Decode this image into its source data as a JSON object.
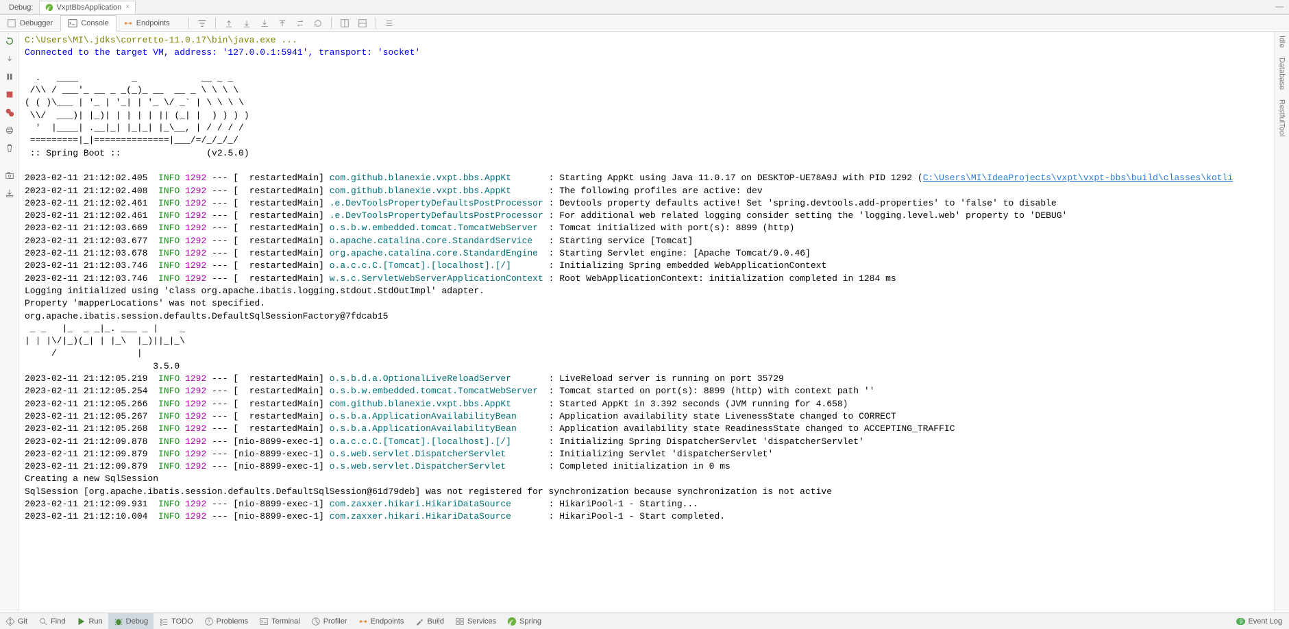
{
  "tabs": {
    "debug_label": "Debug:",
    "app_label": "VxptBbsApplication",
    "close_x": "×"
  },
  "inner_tabs": {
    "debugger": "Debugger",
    "console": "Console",
    "endpoints": "Endpoints"
  },
  "right_sidebar": {
    "idle": "Idle",
    "database": "Database",
    "restful": "RestfulTool"
  },
  "status": {
    "git": "Git",
    "find": "Find",
    "run": "Run",
    "debug": "Debug",
    "todo": "TODO",
    "problems": "Problems",
    "terminal": "Terminal",
    "profiler": "Profiler",
    "endpoints": "Endpoints",
    "build": "Build",
    "services": "Services",
    "spring": "Spring",
    "event_log": "Event Log",
    "badge_count": "9"
  },
  "console": {
    "java_path": "C:\\Users\\MI\\.jdks\\corretto-11.0.17\\bin\\java.exe ...",
    "connected": "Connected to the target VM, address: '127.0.0.1:5941', transport: 'socket'",
    "banner": "  .   ____          _            __ _ _\n /\\\\ / ___'_ __ _ _(_)_ __  __ _ \\ \\ \\ \\\n( ( )\\___ | '_ | '_| | '_ \\/ _` | \\ \\ \\ \\\n \\\\/  ___)| |_)| | | | | || (_| |  ) ) ) )\n  '  |____| .__|_| |_|_| |_\\__, | / / / /\n =========|_|==============|___/=/_/_/_/\n :: Spring Boot ::                (v2.5.0)\n",
    "lines": [
      {
        "ts": "2023-02-11 21:12:02.405",
        "level": "INFO",
        "pid": "1292",
        "thread": "[  restartedMain]",
        "logger": "com.github.blanexie.vxpt.bbs.AppKt",
        "msg": ": Starting AppKt using Java 11.0.17 on DESKTOP-UE78A9J with PID 1292 (",
        "link": "C:\\Users\\MI\\IdeaProjects\\vxpt\\vxpt-bbs\\build\\classes\\kotli"
      },
      {
        "ts": "2023-02-11 21:12:02.408",
        "level": "INFO",
        "pid": "1292",
        "thread": "[  restartedMain]",
        "logger": "com.github.blanexie.vxpt.bbs.AppKt",
        "msg": ": The following profiles are active: dev"
      },
      {
        "ts": "2023-02-11 21:12:02.461",
        "level": "INFO",
        "pid": "1292",
        "thread": "[  restartedMain]",
        "logger": ".e.DevToolsPropertyDefaultsPostProcessor",
        "msg": ": Devtools property defaults active! Set 'spring.devtools.add-properties' to 'false' to disable"
      },
      {
        "ts": "2023-02-11 21:12:02.461",
        "level": "INFO",
        "pid": "1292",
        "thread": "[  restartedMain]",
        "logger": ".e.DevToolsPropertyDefaultsPostProcessor",
        "msg": ": For additional web related logging consider setting the 'logging.level.web' property to 'DEBUG'"
      },
      {
        "ts": "2023-02-11 21:12:03.669",
        "level": "INFO",
        "pid": "1292",
        "thread": "[  restartedMain]",
        "logger": "o.s.b.w.embedded.tomcat.TomcatWebServer",
        "msg": ": Tomcat initialized with port(s): 8899 (http)"
      },
      {
        "ts": "2023-02-11 21:12:03.677",
        "level": "INFO",
        "pid": "1292",
        "thread": "[  restartedMain]",
        "logger": "o.apache.catalina.core.StandardService",
        "msg": ": Starting service [Tomcat]"
      },
      {
        "ts": "2023-02-11 21:12:03.678",
        "level": "INFO",
        "pid": "1292",
        "thread": "[  restartedMain]",
        "logger": "org.apache.catalina.core.StandardEngine",
        "msg": ": Starting Servlet engine: [Apache Tomcat/9.0.46]"
      },
      {
        "ts": "2023-02-11 21:12:03.746",
        "level": "INFO",
        "pid": "1292",
        "thread": "[  restartedMain]",
        "logger": "o.a.c.c.C.[Tomcat].[localhost].[/]",
        "msg": ": Initializing Spring embedded WebApplicationContext"
      },
      {
        "ts": "2023-02-11 21:12:03.746",
        "level": "INFO",
        "pid": "1292",
        "thread": "[  restartedMain]",
        "logger": "w.s.c.ServletWebServerApplicationContext",
        "msg": ": Root WebApplicationContext: initialization completed in 1284 ms"
      }
    ],
    "plain_block": "Logging initialized using 'class org.apache.ibatis.logging.stdout.StdOutImpl' adapter.\nProperty 'mapperLocations' was not specified.\norg.apache.ibatis.session.defaults.DefaultSqlSessionFactory@7fdcab15\n _ _   |_  _ _|_. ___ _ |    _ \n| | |\\/|_)(_| | |_\\  |_)||_|_\\ \n     /               |         \n                        3.5.0 ",
    "lines2": [
      {
        "ts": "2023-02-11 21:12:05.219",
        "level": "INFO",
        "pid": "1292",
        "thread": "[  restartedMain]",
        "logger": "o.s.b.d.a.OptionalLiveReloadServer",
        "msg": ": LiveReload server is running on port 35729"
      },
      {
        "ts": "2023-02-11 21:12:05.254",
        "level": "INFO",
        "pid": "1292",
        "thread": "[  restartedMain]",
        "logger": "o.s.b.w.embedded.tomcat.TomcatWebServer",
        "msg": ": Tomcat started on port(s): 8899 (http) with context path ''"
      },
      {
        "ts": "2023-02-11 21:12:05.266",
        "level": "INFO",
        "pid": "1292",
        "thread": "[  restartedMain]",
        "logger": "com.github.blanexie.vxpt.bbs.AppKt",
        "msg": ": Started AppKt in 3.392 seconds (JVM running for 4.658)"
      },
      {
        "ts": "2023-02-11 21:12:05.267",
        "level": "INFO",
        "pid": "1292",
        "thread": "[  restartedMain]",
        "logger": "o.s.b.a.ApplicationAvailabilityBean",
        "msg": ": Application availability state LivenessState changed to CORRECT"
      },
      {
        "ts": "2023-02-11 21:12:05.268",
        "level": "INFO",
        "pid": "1292",
        "thread": "[  restartedMain]",
        "logger": "o.s.b.a.ApplicationAvailabilityBean",
        "msg": ": Application availability state ReadinessState changed to ACCEPTING_TRAFFIC"
      },
      {
        "ts": "2023-02-11 21:12:09.878",
        "level": "INFO",
        "pid": "1292",
        "thread": "[nio-8899-exec-1]",
        "logger": "o.a.c.c.C.[Tomcat].[localhost].[/]",
        "msg": ": Initializing Spring DispatcherServlet 'dispatcherServlet'"
      },
      {
        "ts": "2023-02-11 21:12:09.879",
        "level": "INFO",
        "pid": "1292",
        "thread": "[nio-8899-exec-1]",
        "logger": "o.s.web.servlet.DispatcherServlet",
        "msg": ": Initializing Servlet 'dispatcherServlet'"
      },
      {
        "ts": "2023-02-11 21:12:09.879",
        "level": "INFO",
        "pid": "1292",
        "thread": "[nio-8899-exec-1]",
        "logger": "o.s.web.servlet.DispatcherServlet",
        "msg": ": Completed initialization in 0 ms"
      }
    ],
    "plain_block2": "Creating a new SqlSession\nSqlSession [org.apache.ibatis.session.defaults.DefaultSqlSession@61d79deb] was not registered for synchronization because synchronization is not active",
    "lines3": [
      {
        "ts": "2023-02-11 21:12:09.931",
        "level": "INFO",
        "pid": "1292",
        "thread": "[nio-8899-exec-1]",
        "logger": "com.zaxxer.hikari.HikariDataSource",
        "msg": ": HikariPool-1 - Starting..."
      },
      {
        "ts": "2023-02-11 21:12:10.004",
        "level": "INFO",
        "pid": "1292",
        "thread": "[nio-8899-exec-1]",
        "logger": "com.zaxxer.hikari.HikariDataSource",
        "msg": ": HikariPool-1 - Start completed."
      }
    ]
  }
}
